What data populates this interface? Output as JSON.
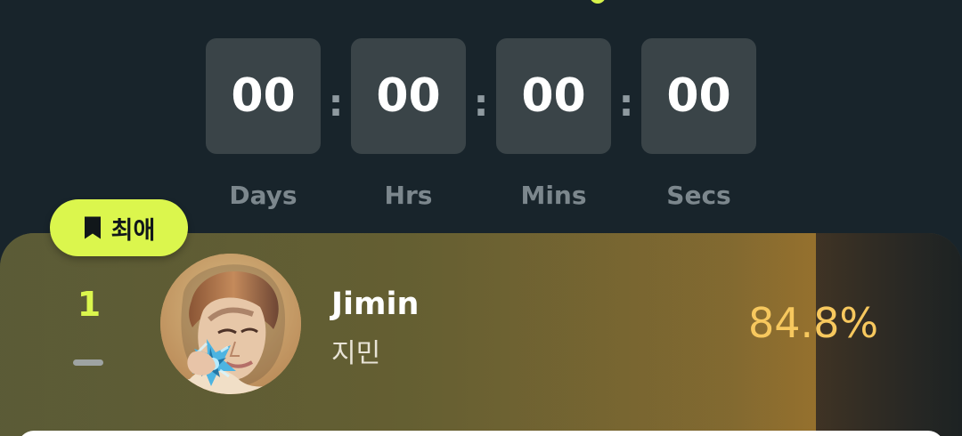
{
  "countdown": {
    "days": "00",
    "hours": "00",
    "minutes": "00",
    "seconds": "00",
    "separator": ":",
    "labels": {
      "days": "Days",
      "hours": "Hrs",
      "minutes": "Mins",
      "seconds": "Secs"
    }
  },
  "favorite_badge": {
    "label": "최애",
    "icon": "bookmark-icon"
  },
  "ranking": {
    "rank": "1",
    "rank_change_icon": "dash-icon",
    "name_en": "Jimin",
    "name_ko": "지민",
    "percentage": "84.8%",
    "progress_value": 0.848
  },
  "colors": {
    "background": "#18242b",
    "accent": "#dbf64d",
    "timer_box": "#3a4448",
    "percentage": "#f7c85e"
  }
}
